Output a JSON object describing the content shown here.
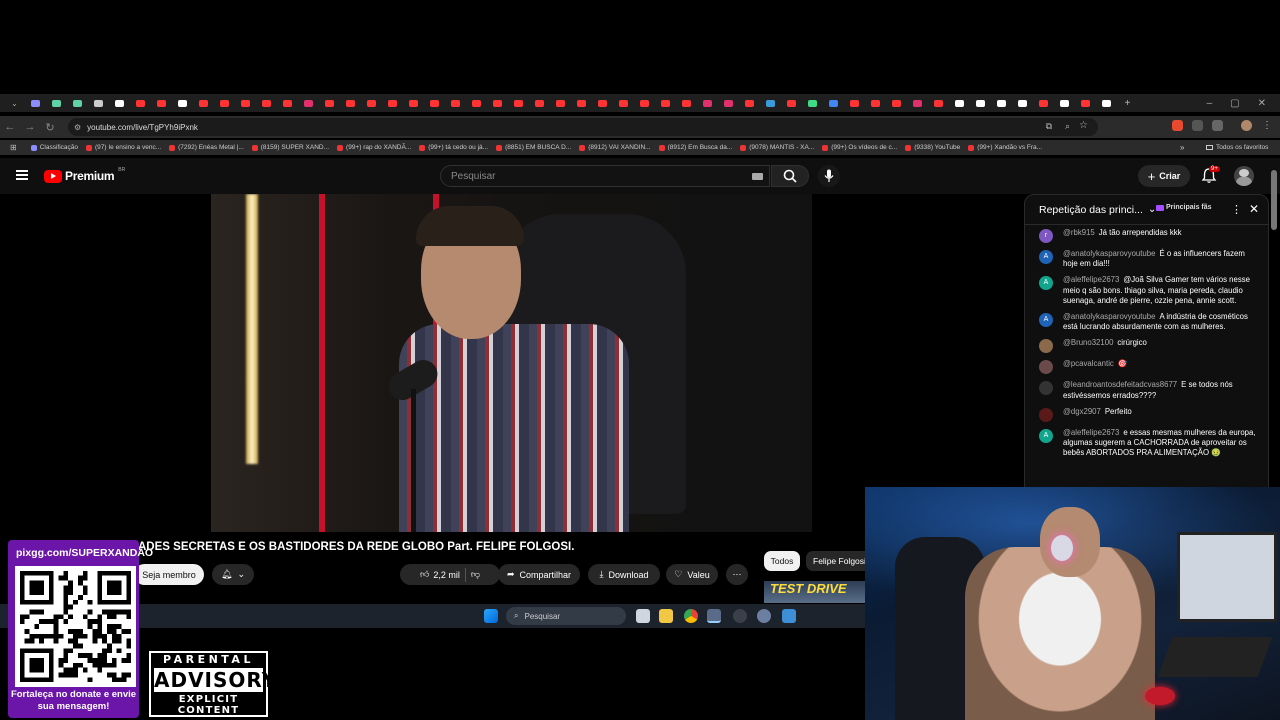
{
  "browser": {
    "url": "youtube.com/live/TgPYh9iPxnk",
    "tab_colors": [
      "#8c8cff",
      "#5fd3a6",
      "#5fd3a6",
      "#cccccc",
      "#ffffff",
      "#ff3333",
      "#ff3333",
      "#ffffff",
      "#ff3333",
      "#ff3333",
      "#ff3333",
      "#ff3333",
      "#ff3333",
      "#e1306c",
      "#ff3333",
      "#ff3333",
      "#ff3333",
      "#ff3333",
      "#ff3333",
      "#ff3333",
      "#ff3333",
      "#ff3333",
      "#ff3333",
      "#ff3333",
      "#ff3333",
      "#ff3333",
      "#ff3333",
      "#ff3333",
      "#ff3333",
      "#ff3333",
      "#ff3333",
      "#ff3333",
      "#e1306c",
      "#e1306c",
      "#ff3333",
      "#3a9bdc",
      "#ff3333",
      "#3ddc84",
      "#4285f4",
      "#ff3333",
      "#ff3333",
      "#ff3333",
      "#e1306c",
      "#ff3333",
      "#ffffff",
      "#ffffff",
      "#ffffff",
      "#ffffff",
      "#ff3333",
      "#ffffff",
      "#ff3333",
      "#ffffff"
    ],
    "bookmarks": [
      "Classificação",
      "(97) Ie ensino a venc...",
      "(7292) Enéas Metal |...",
      "(8159) SUPER XAND...",
      "(99+) rap do XANDÃ...",
      "(99+) tá cedo ou já...",
      "(8851) EM BUSCA D...",
      "(8912) VAI XANDIN...",
      "(8912) Em Busca da...",
      "(9078) MANTIS - XA...",
      "(99+) Os vídeos de c...",
      "(9338) YouTube",
      "(99+) Xandão vs Fra..."
    ],
    "bookmarks_overflow": "»",
    "all_bookmarks": "Todos os favoritos"
  },
  "youtube": {
    "logo_text": "Premium",
    "logo_region": "BR",
    "search_placeholder": "Pesquisar",
    "create_label": "Criar",
    "notif_count": "9+"
  },
  "video": {
    "title": "ADES SECRETAS E OS BASTIDORES DA REDE GLOBO Part. FELIPE FOLGOSI.",
    "join_label": "Seja membro",
    "likes": "2,2 mil",
    "share_label": "Compartilhar",
    "download_label": "Download",
    "thanks_label": "Valeu",
    "chip_all": "Todos",
    "chip_channel": "Felipe Folgosi",
    "rec_thumb_text": "TEST DRIVE"
  },
  "taskbar": {
    "search_placeholder": "Pesquisar"
  },
  "chat": {
    "header": "Repetição das princi...",
    "top_fans": "Principais fãs",
    "messages": [
      {
        "author": "@rbk915",
        "text": "Já tão arrependidas kkk",
        "initial": "r",
        "color": "#7e57c2"
      },
      {
        "author": "@anatolykasparovyoutube",
        "text": "É o as influencers fazem hoje em dia!!!",
        "initial": "A",
        "color": "#1e63b5"
      },
      {
        "author": "@aleffelipe2673",
        "text": "@Joã Silva Gamer tem vários nesse meio q são bons. thiago silva, maria pereda, claudio suenaga, andré de pierre, ozzie pena, annie scott.",
        "initial": "A",
        "color": "#12a58d"
      },
      {
        "author": "@anatolykasparovyoutube",
        "text": "A indústria de cosméticos está lucrando absurdamente com as mulheres.",
        "initial": "A",
        "color": "#1e63b5"
      },
      {
        "author": "@Bruno32100",
        "text": "cirúrgico",
        "initial": "",
        "color": "#8a6a4a"
      },
      {
        "author": "@pcavalcantic",
        "text": "🎯",
        "initial": "",
        "color": "#6a4a4a"
      },
      {
        "author": "@leandroantosdefeitadcvas8677",
        "text": "E se todos nós estivéssemos errados????",
        "initial": "",
        "color": "#333333"
      },
      {
        "author": "@dgx2907",
        "text": "Perfeito",
        "initial": "",
        "color": "#5a1a1a"
      },
      {
        "author": "@aleffelipe2673",
        "text": "e essas mesmas mulheres da europa, algumas sugerem a CACHORRADA de aproveitar os bebês ABORTADOS PRA ALIMENTAÇÃO 🤢",
        "initial": "A",
        "color": "#12a58d"
      }
    ]
  },
  "overlay": {
    "qr_url": "pixgg.com/SUPERXANDÃO",
    "qr_message": "Fortaleça no donate e envie sua mensagem!",
    "advisory_line1": "PARENTAL",
    "advisory_line2": "ADVISORY",
    "advisory_line3": "EXPLICIT CONTENT"
  }
}
